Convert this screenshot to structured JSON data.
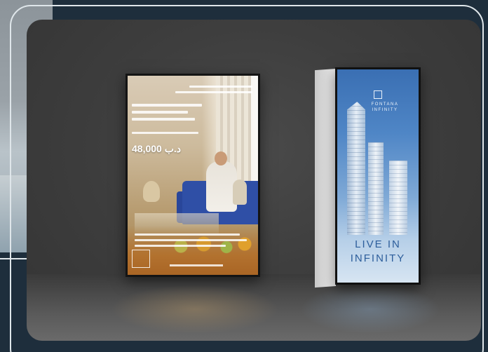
{
  "left_lightbox": {
    "price": "48,000 د.ب"
  },
  "right_lightbox": {
    "brand_line1": "FONTANA",
    "brand_line2": "INFINITY",
    "cta_line1": "LIVE IN",
    "cta_line2": "INFINITY"
  },
  "colors": {
    "page_background": "#1e2e3c",
    "frame_outline": "#dfe6ea",
    "wall": "#3e3e3e",
    "sofa_blue": "#2f4fa6",
    "sky_blue": "#4f86c6"
  }
}
